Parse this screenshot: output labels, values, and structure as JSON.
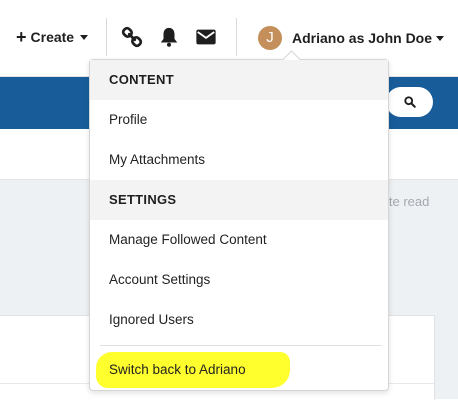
{
  "header": {
    "create_label": "Create",
    "plus_symbol": "+",
    "icons": [
      "link-icon",
      "bell-icon",
      "envelope-icon"
    ],
    "avatar_initial": "J",
    "avatar_color": "#c48f5a",
    "user_label": "Adriano as John Doe"
  },
  "band": {
    "color": "#185d9a",
    "search_icon": "search-icon"
  },
  "background": {
    "truncated_text": "ite read"
  },
  "menu": {
    "sections": [
      {
        "heading": "CONTENT",
        "items": [
          "Profile",
          "My Attachments"
        ]
      },
      {
        "heading": "SETTINGS",
        "items": [
          "Manage Followed Content",
          "Account Settings",
          "Ignored Users"
        ]
      }
    ],
    "footer_item": "Switch back to Adriano",
    "highlight_color": "#ffff22"
  }
}
